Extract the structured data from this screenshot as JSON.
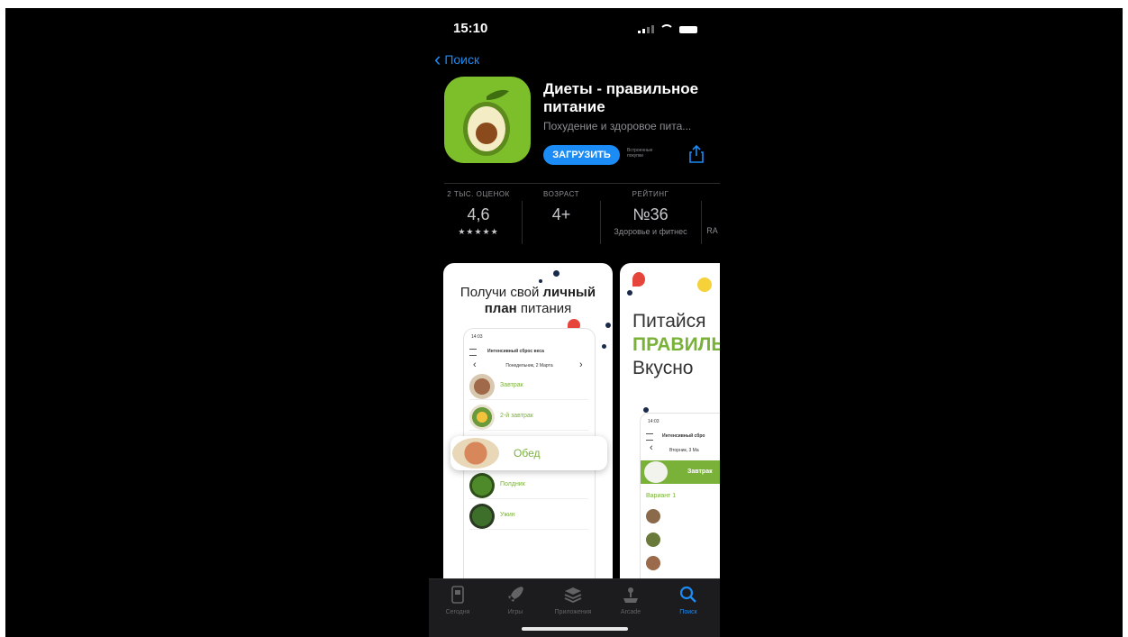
{
  "status": {
    "time": "15:10"
  },
  "nav": {
    "back_label": "Поиск"
  },
  "app": {
    "title": "Диеты - правильное питание",
    "subtitle": "Похудение и здоровое пита...",
    "get_label": "ЗАГРУЗИТЬ",
    "iap_note": "Встроенные покупки"
  },
  "stats": [
    {
      "header": "2 ТЫС. ОЦЕНОК",
      "value": "4,6",
      "sub": "★★★★★"
    },
    {
      "header": "ВОЗРАСТ",
      "value": "4+",
      "sub": ""
    },
    {
      "header": "РЕЙТИНГ",
      "value": "№36",
      "sub": "Здоровье и фитнес"
    },
    {
      "header": "",
      "value": "",
      "sub": "RA"
    }
  ],
  "screenshot1": {
    "head_pre": "Получи свой ",
    "head_bold": "личный план",
    "head_post": " питания",
    "phone_time": "14:03",
    "phone_title": "Интенсивный сброс веса",
    "date": "Понедельник, 2 Марта",
    "meals": [
      "Завтрак",
      "2-й завтрак",
      "Полдник",
      "Ужин"
    ],
    "highlight": "Обед"
  },
  "screenshot2": {
    "line1": "Питайся",
    "line2": "ПРАВИЛЬ",
    "line3": "Вкусно",
    "phone_time": "14:03",
    "phone_title": "Интенсивный сбро",
    "date": "Вторник, 3 Ма",
    "section": "Завтрак",
    "variant": "Вариант 1"
  },
  "tabs": [
    {
      "label": "Сегодня",
      "icon": "today-icon"
    },
    {
      "label": "Игры",
      "icon": "rocket-icon"
    },
    {
      "label": "Приложения",
      "icon": "apps-stack-icon"
    },
    {
      "label": "Arcade",
      "icon": "joystick-icon"
    },
    {
      "label": "Поиск",
      "icon": "search-icon",
      "active": true
    }
  ],
  "colors": {
    "accent": "#1b8bf5",
    "green": "#7ab239",
    "icon_bg": "#7cbf2a"
  }
}
